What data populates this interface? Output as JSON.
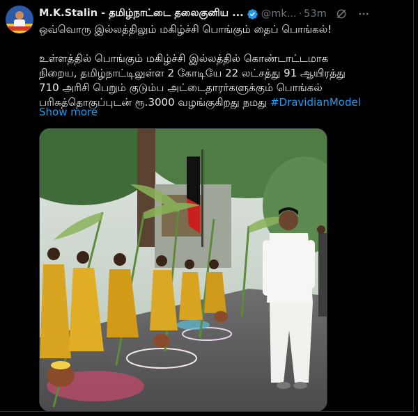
{
  "tweet": {
    "author_name": "M.K.Stalin - தமிழ்நாட்டை தலைகுனிய ...",
    "handle": "@mk...",
    "separator": "·",
    "time": "53m",
    "lines": [
      "ஒவ்வொரு இல்லத்திலும் மகிழ்ச்சி பொங்கும் தைப் பொங்கல்!",
      "உள்ளத்தில் பொங்கும் மகிழ்ச்சி இல்லத்தில் கொண்டாட்டமாக",
      "நிறைய, தமிழ்நாட்டிலுள்ள 2 கோடியே 22 லட்சத்து 91 ஆயிரத்து",
      "710 அரிசி பெறும் குடும்ப அட்டைதாரர்களுக்கும் பொங்கல்",
      "பரிசுத்தொகுப்புடன் ரூ.3000 வழங்குகிறது நமது "
    ],
    "hashtag": "#DravidianModel",
    "show_more": "Show more"
  },
  "icons": {
    "verified": "verified-badge-icon",
    "grok": "grok-icon",
    "more": "more-options-icon"
  },
  "colors": {
    "background": "#000000",
    "text": "#e7e9ea",
    "muted": "#71767b",
    "link": "#1d9bf0",
    "verified": "#1d9bf0"
  }
}
